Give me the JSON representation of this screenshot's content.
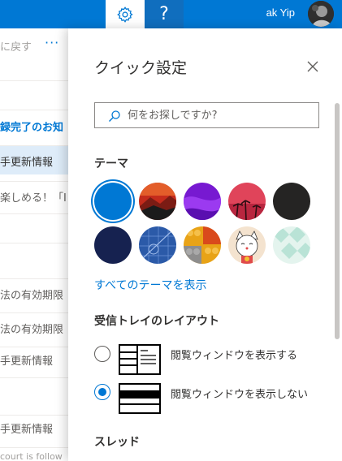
{
  "topbar": {
    "gear_icon": "gear-icon",
    "help_label": "?",
    "user_name": "ak Yip",
    "accent": "#0078d4"
  },
  "list": {
    "back_label": "に戻す",
    "more_label": "···",
    "rows": [
      {
        "text": "録完了のお知"
      },
      {
        "text": "手更新情報"
      },
      {
        "text": "楽しめる！「I"
      },
      {
        "text": ""
      },
      {
        "text": "法の有効期限"
      },
      {
        "text": "法の有効期限"
      },
      {
        "text": "手更新情報"
      },
      {
        "text": ""
      },
      {
        "text": "手更新情報"
      },
      {
        "text": "court is follow"
      }
    ]
  },
  "panel": {
    "title": "クイック設定",
    "search_placeholder": "何をお探しですか?",
    "theme_heading": "テーマ",
    "themes": [
      {
        "name": "blue",
        "color": "#0078d4",
        "selected": true
      },
      {
        "name": "mountains",
        "color": "#c42b1c"
      },
      {
        "name": "purple",
        "color": "#7719d1"
      },
      {
        "name": "palms",
        "color": "#e0445a"
      },
      {
        "name": "dark",
        "color": "#252423"
      },
      {
        "name": "navy",
        "color": "#162250"
      },
      {
        "name": "blueprint",
        "color": "#2b5aa8"
      },
      {
        "name": "bricks",
        "color": "#e8a317"
      },
      {
        "name": "cat",
        "color": "#f4e3cf"
      },
      {
        "name": "mint",
        "color": "#b9e3d6"
      }
    ],
    "all_themes_link": "すべてのテーマを表示",
    "inbox_layout_heading": "受信トレイのレイアウト",
    "layout_options": [
      {
        "label": "閲覧ウィンドウを表示する",
        "selected": false
      },
      {
        "label": "閲覧ウィンドウを表示しない",
        "selected": true
      }
    ],
    "thread_heading": "スレッド"
  }
}
